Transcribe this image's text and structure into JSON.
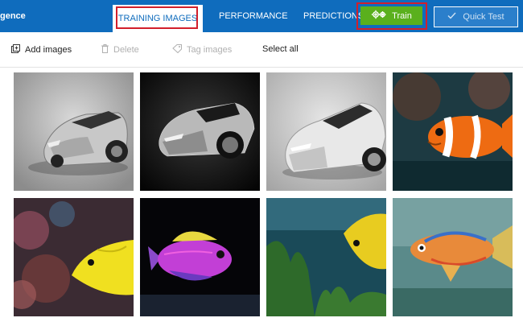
{
  "header": {
    "brand": "gence",
    "tabs": [
      {
        "label": "TRAINING IMAGES"
      },
      {
        "label": "PERFORMANCE"
      },
      {
        "label": "PREDICTIONS"
      }
    ],
    "train_label": "Train",
    "quick_test_label": "Quick Test"
  },
  "toolbar": {
    "add_images": "Add images",
    "delete": "Delete",
    "tag_images": "Tag images",
    "select_all": "Select all"
  },
  "colors": {
    "header_bg": "#0f6cbd",
    "train_green": "#5ab01d",
    "highlight_red": "#d21f2b"
  },
  "images": [
    {
      "subject": "silver sports car"
    },
    {
      "subject": "silver sports car"
    },
    {
      "subject": "silver sports car"
    },
    {
      "subject": "clownfish"
    },
    {
      "subject": "yellow fish"
    },
    {
      "subject": "purple fish"
    },
    {
      "subject": "yellow fish"
    },
    {
      "subject": "orange fish"
    }
  ]
}
